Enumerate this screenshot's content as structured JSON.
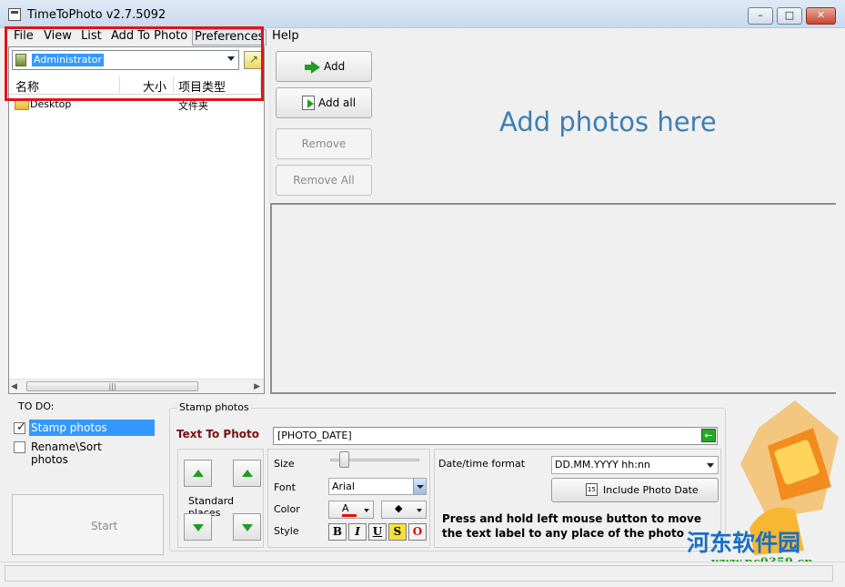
{
  "window": {
    "title": "TimeToPhoto v2.7.5092"
  },
  "menu": [
    "File",
    "View",
    "List",
    "Add To Photo",
    "Preferences",
    "Help"
  ],
  "explorer": {
    "folder": "Administrator",
    "columns": [
      "名称",
      "大小",
      "项目类型"
    ],
    "rows": [
      {
        "name": "Desktop",
        "type": "文件夹"
      }
    ]
  },
  "actions": {
    "add": "Add",
    "add_all": "Add all",
    "remove": "Remove",
    "remove_all": "Remove All"
  },
  "dropzone": {
    "hint": "Add photos here"
  },
  "todo": {
    "label": "TO DO:",
    "items": [
      {
        "label": "Stamp photos",
        "checked": true
      },
      {
        "label": "Rename\\Sort photos",
        "checked": false
      }
    ],
    "start": "Start"
  },
  "stamp": {
    "group_label": "Stamp photos",
    "text_label": "Text To Photo",
    "text_value": "[PHOTO_DATE]",
    "places_label": "Standard places",
    "size_label": "Size",
    "font_label": "Font",
    "font_value": "Arial",
    "color_label": "Color",
    "style_label": "Style",
    "style_buttons": [
      "B",
      "I",
      "U",
      "S",
      "O"
    ],
    "datetime_label": "Date/time format",
    "datetime_value": "DD.MM.YYYY hh:nn",
    "include_date": "Include Photo Date",
    "help": "Press and hold left mouse button to move the text label to any place of the photo"
  },
  "watermark": {
    "name": "河东软件园",
    "url": "www.pc0359.cn"
  },
  "colors": {
    "accent": "#3399ff",
    "hint": "#3e7fb1",
    "highlight": "#e0141c"
  }
}
